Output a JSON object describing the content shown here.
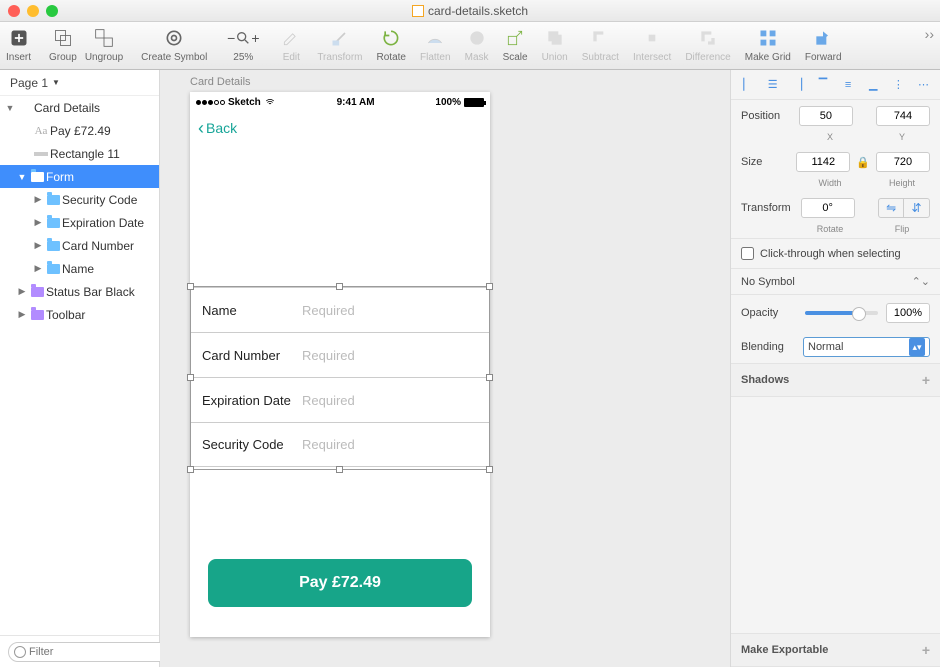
{
  "window": {
    "title": "card-details.sketch"
  },
  "toolbar": {
    "insert": "Insert",
    "group": "Group",
    "ungroup": "Ungroup",
    "create_symbol": "Create Symbol",
    "zoom": "25%",
    "edit": "Edit",
    "transform": "Transform",
    "rotate": "Rotate",
    "flatten": "Flatten",
    "mask": "Mask",
    "scale": "Scale",
    "union": "Union",
    "subtract": "Subtract",
    "intersect": "Intersect",
    "difference": "Difference",
    "make_grid": "Make Grid",
    "forward": "Forward"
  },
  "sidebar": {
    "page": "Page 1",
    "items": [
      {
        "label": "Card Details"
      },
      {
        "label": "Pay £72.49"
      },
      {
        "label": "Rectangle 11"
      },
      {
        "label": "Form"
      },
      {
        "label": "Security Code"
      },
      {
        "label": "Expiration Date"
      },
      {
        "label": "Card Number"
      },
      {
        "label": "Name"
      },
      {
        "label": "Status Bar Black"
      },
      {
        "label": "Toolbar"
      }
    ],
    "filter_placeholder": "Filter"
  },
  "canvas": {
    "artboard_name": "Card Details",
    "statusbar": {
      "carrier": "Sketch",
      "time": "9:41 AM",
      "battery": "100%"
    },
    "back": "Back",
    "form": {
      "name_label": "Name",
      "card_label": "Card Number",
      "exp_label": "Expiration Date",
      "sec_label": "Security Code",
      "placeholder": "Required"
    },
    "pay_button": "Pay £72.49"
  },
  "inspector": {
    "position_label": "Position",
    "x": "50",
    "y": "744",
    "x_sub": "X",
    "y_sub": "Y",
    "size_label": "Size",
    "width": "1142",
    "height": "720",
    "w_sub": "Width",
    "h_sub": "Height",
    "transform_label": "Transform",
    "rotate": "0°",
    "rotate_sub": "Rotate",
    "flip_sub": "Flip",
    "click_through": "Click-through when selecting",
    "no_symbol": "No Symbol",
    "opacity_label": "Opacity",
    "opacity_value": "100%",
    "blending_label": "Blending",
    "blending_value": "Normal",
    "shadows": "Shadows",
    "make_exportable": "Make Exportable"
  }
}
